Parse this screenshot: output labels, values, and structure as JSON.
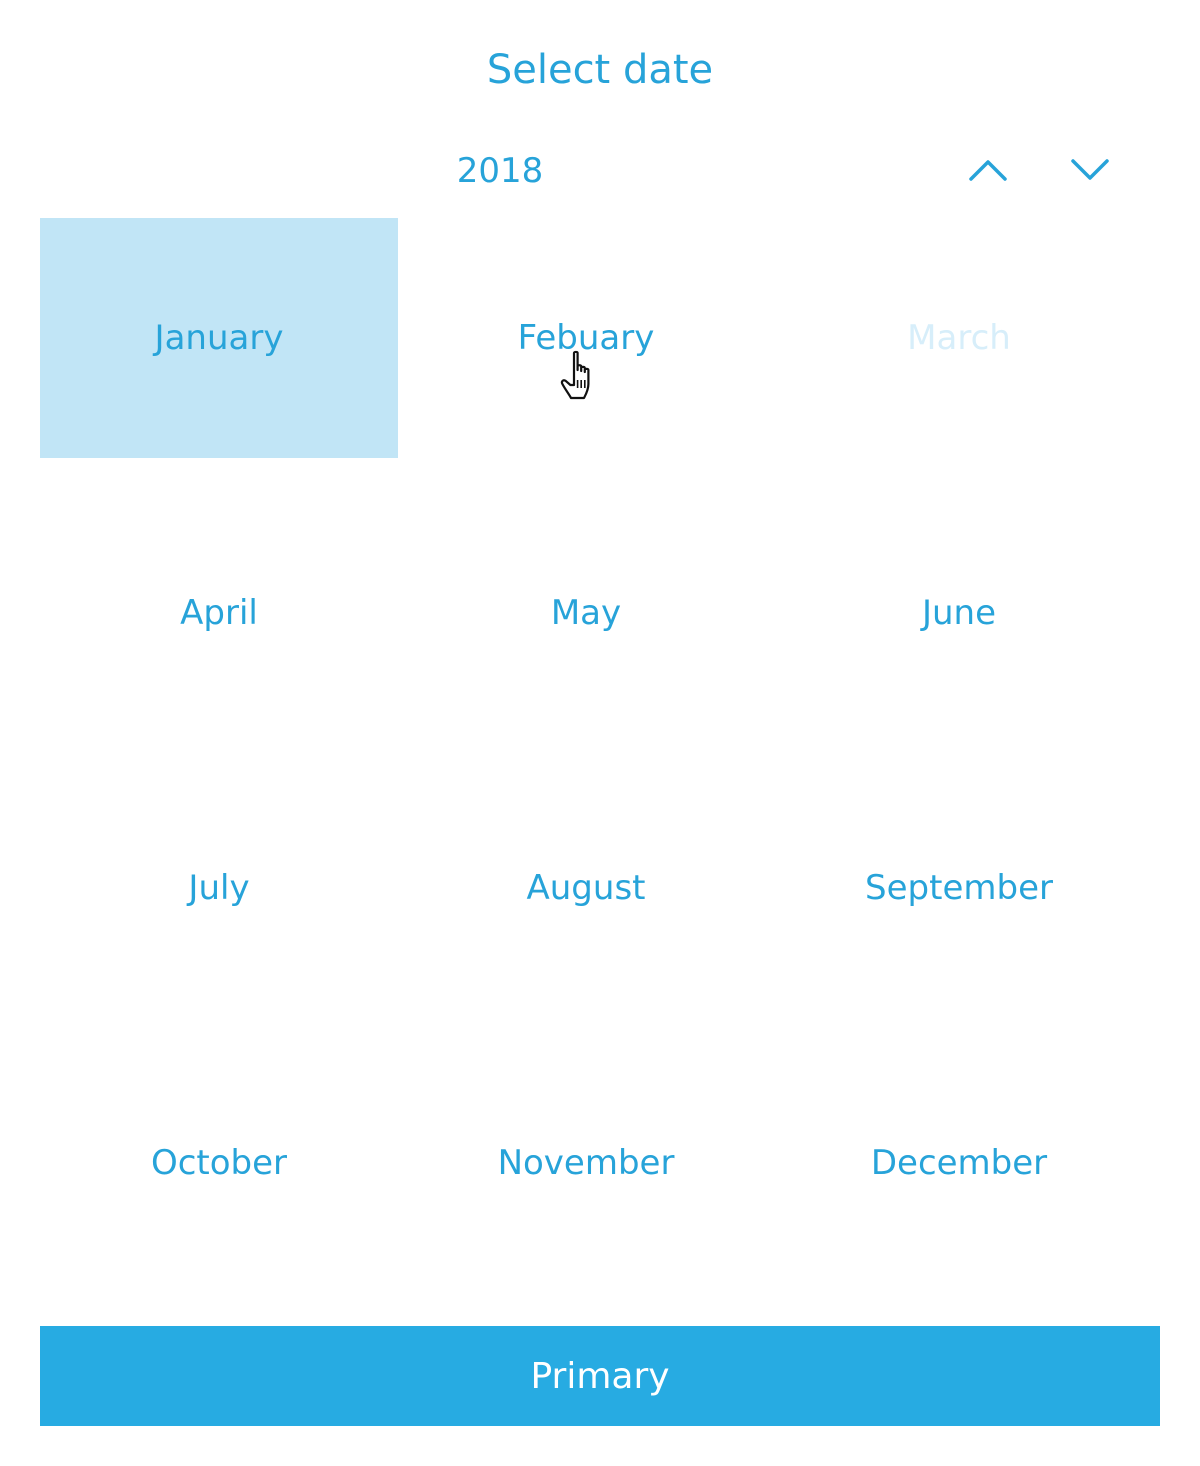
{
  "header": {
    "title": "Select date"
  },
  "year_selector": {
    "year": "2018",
    "prev_icon": "chevron-up-icon",
    "next_icon": "chevron-down-icon"
  },
  "months": [
    {
      "label": "January",
      "state": "selected"
    },
    {
      "label": "Febuary",
      "state": "hover"
    },
    {
      "label": "March",
      "state": "disabled"
    },
    {
      "label": "April",
      "state": "normal"
    },
    {
      "label": "May",
      "state": "normal"
    },
    {
      "label": "June",
      "state": "normal"
    },
    {
      "label": "July",
      "state": "normal"
    },
    {
      "label": "August",
      "state": "normal"
    },
    {
      "label": "September",
      "state": "normal"
    },
    {
      "label": "October",
      "state": "normal"
    },
    {
      "label": "November",
      "state": "normal"
    },
    {
      "label": "December",
      "state": "normal"
    }
  ],
  "footer": {
    "primary_label": "Primary"
  },
  "colors": {
    "accent": "#27a3d9",
    "selected_bg": "#c1e5f6",
    "disabled_text": "#d7eefa",
    "button_bg": "#27abe2",
    "button_text": "#ffffff"
  },
  "cursor": {
    "icon": "hand-pointer-icon"
  }
}
